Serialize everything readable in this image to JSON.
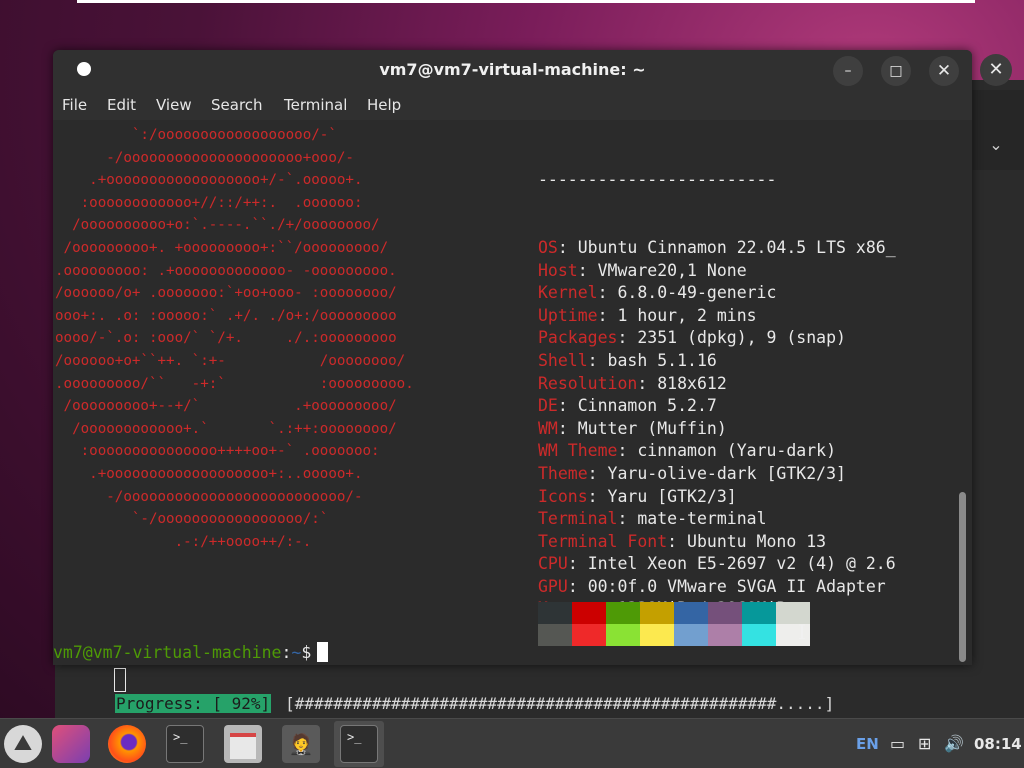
{
  "window": {
    "title": "vm7@vm7-virtual-machine: ~",
    "menu": [
      "File",
      "Edit",
      "View",
      "Search",
      "Terminal",
      "Help"
    ],
    "minimize_glyph": "–",
    "maximize_glyph": "□",
    "close_glyph": "✕"
  },
  "ascii_art": [
    "         `:/oooooooooooooooooo/-`",
    "      -/ooooooooooooooooooooo+ooo/-",
    "    .+oooooooooooooooooo+/-`.ooooo+.",
    "   :oooooooooooo+//::/++:.  .oooooo:",
    "  /oooooooooo+o:`.----.``./+/oooooooo/",
    " /ooooooooo+. +ooooooooo+:``/ooooooooo/",
    ".ooooooooo: .+ooooooooooooo- -ooooooooo.",
    "/oooooo/o+ .ooooooo:`+oo+ooo- :oooooooo/",
    "ooo+:. .o: :ooooo:` .+/. ./o+:/ooooooooo",
    "oooo/-`.o: :ooo/` `/+.     ./.:ooooooooo",
    "/oooooo+o+``++. `:+-           /oooooooo/",
    ".ooooooooo/``   -+:`           :ooooooooo.",
    " /ooooooooo+--+/`           .+ooooooooo/",
    "  /oooooooooooo+.`       `.:++:oooooooo/",
    "   :ooooooooooooooo++++oo+-` .ooooooo:",
    "    .+ooooooooooooooooooo+:..ooooo+.",
    "      -/oooooooooooooooooooooooooo/-",
    "         `-/ooooooooooooooooo/:`",
    "              .-:/++oooo++/:-."
  ],
  "info": {
    "separator": "------------------------",
    "rows": [
      {
        "key": "OS",
        "value": "Ubuntu Cinnamon 22.04.5 LTS x86_"
      },
      {
        "key": "Host",
        "value": "VMware20,1 None"
      },
      {
        "key": "Kernel",
        "value": "6.8.0-49-generic"
      },
      {
        "key": "Uptime",
        "value": "1 hour, 2 mins"
      },
      {
        "key": "Packages",
        "value": "2351 (dpkg), 9 (snap)"
      },
      {
        "key": "Shell",
        "value": "bash 5.1.16"
      },
      {
        "key": "Resolution",
        "value": "818x612"
      },
      {
        "key": "DE",
        "value": "Cinnamon 5.2.7"
      },
      {
        "key": "WM",
        "value": "Mutter (Muffin)"
      },
      {
        "key": "WM Theme",
        "value": "cinnamon (Yaru-dark)"
      },
      {
        "key": "Theme",
        "value": "Yaru-olive-dark [GTK2/3]"
      },
      {
        "key": "Icons",
        "value": "Yaru [GTK2/3]"
      },
      {
        "key": "Terminal",
        "value": "mate-terminal"
      },
      {
        "key": "Terminal Font",
        "value": "Ubuntu Mono 13"
      },
      {
        "key": "CPU",
        "value": "Intel Xeon E5-2697 v2 (4) @ 2.6"
      },
      {
        "key": "GPU",
        "value": "00:0f.0 VMware SVGA II Adapter"
      },
      {
        "key": "Memory",
        "value": "1339MiB / 3868MiB"
      }
    ]
  },
  "palette": {
    "row1": [
      "#2e3436",
      "#cc0000",
      "#4e9a06",
      "#c4a000",
      "#3465a4",
      "#75507b",
      "#06989a",
      "#d3d7cf"
    ],
    "row2": [
      "#555753",
      "#ef2929",
      "#8ae234",
      "#fce94f",
      "#729fcf",
      "#ad7fa8",
      "#34e2e2",
      "#eeeeec"
    ]
  },
  "prompt": {
    "user_host": "vm7@vm7-virtual-machine",
    "colon": ":",
    "path": "~",
    "symbol": "$"
  },
  "background_terminal": {
    "progress_label": "Progress: [ 92%]",
    "progress_bar": "[##################################################.....]",
    "progress_percent": 92
  },
  "taskbar": {
    "menu_glyph": "⛰",
    "term_glyph": ">_",
    "mate_glyph": "🤵",
    "language": "EN",
    "screen_glyph": "▭",
    "network_glyph": "⊞",
    "volume_glyph": "🔊",
    "clock": "08:14"
  },
  "side": {
    "close_glyph": "✕",
    "chevron_glyph": "⌄"
  }
}
